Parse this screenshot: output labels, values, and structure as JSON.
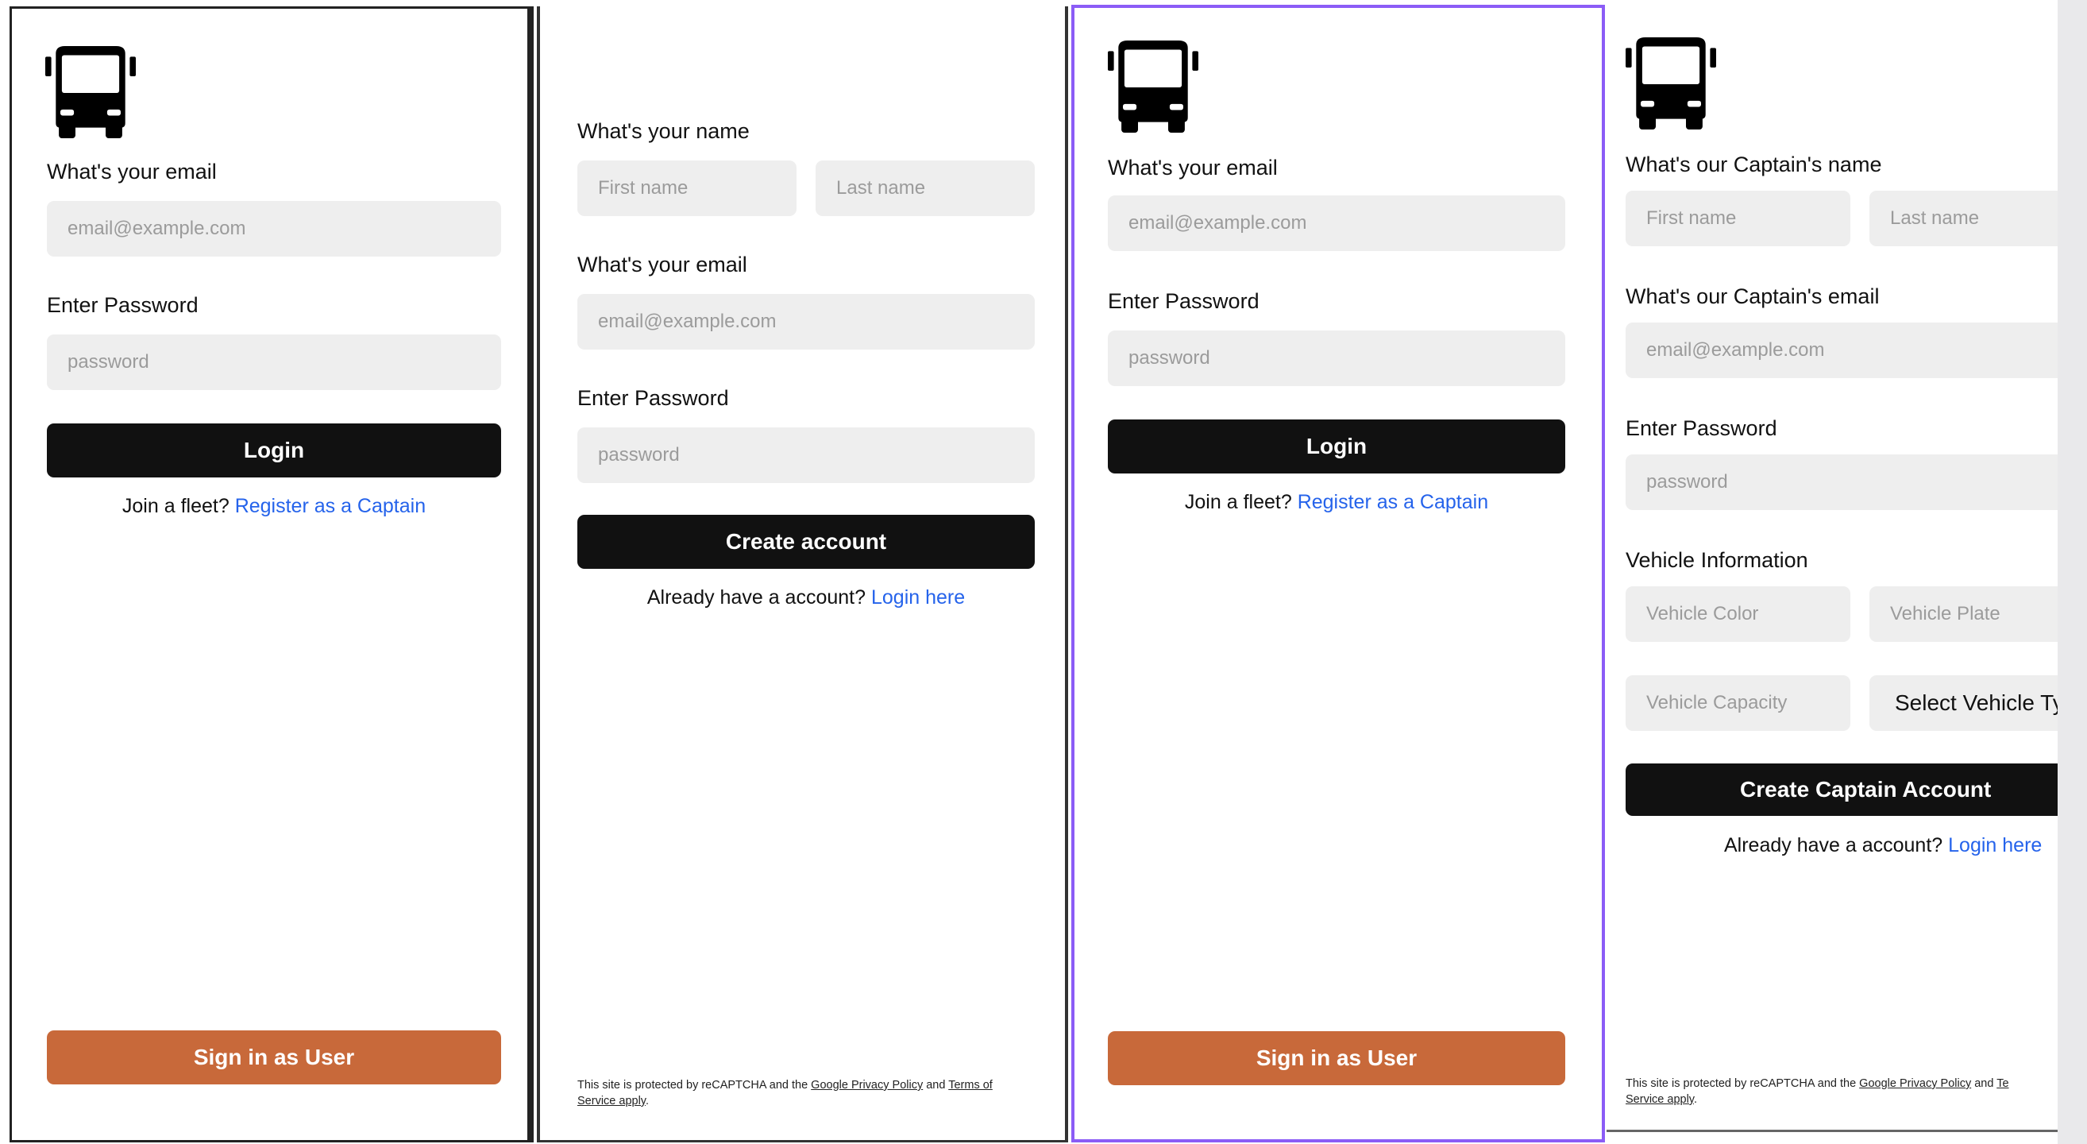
{
  "colors": {
    "accent_border": "#8b5cf6",
    "button_dark": "#111111",
    "button_orange": "#c8693a",
    "link": "#2563eb",
    "input_bg": "#eeeeee"
  },
  "logo_icon": "bus-icon",
  "panel1": {
    "email_label": "What's your email",
    "email_placeholder": "email@example.com",
    "password_label": "Enter Password",
    "password_placeholder": "password",
    "login_button": "Login",
    "join_prefix": "Join a fleet?",
    "join_link": "Register as a Captain",
    "sign_in_user_button": "Sign in as User"
  },
  "panel2": {
    "name_label": "What's your name",
    "first_name_placeholder": "First name",
    "last_name_placeholder": "Last name",
    "email_label": "What's your email",
    "email_placeholder": "email@example.com",
    "password_label": "Enter Password",
    "password_placeholder": "password",
    "create_button": "Create account",
    "have_account_prefix": "Already have a account?",
    "login_link": "Login here",
    "recaptcha_text": "This site is protected by reCAPTCHA and the",
    "privacy_link": "Google Privacy Policy",
    "and_text": "and",
    "terms_link": "Terms of Service apply",
    "period": "."
  },
  "panel3": {
    "email_label": "What's your email",
    "email_placeholder": "email@example.com",
    "password_label": "Enter Password",
    "password_placeholder": "password",
    "login_button": "Login",
    "join_prefix": "Join a fleet?",
    "join_link": "Register as a Captain",
    "sign_in_user_button": "Sign in as User"
  },
  "panel4": {
    "name_label": "What's our Captain's name",
    "first_name_placeholder": "First name",
    "last_name_placeholder": "Last name",
    "email_label": "What's our Captain's email",
    "email_placeholder": "email@example.com",
    "password_label": "Enter Password",
    "password_placeholder": "password",
    "vehicle_label": "Vehicle Information",
    "vehicle_color_placeholder": "Vehicle Color",
    "vehicle_plate_placeholder": "Vehicle Plate",
    "vehicle_capacity_placeholder": "Vehicle Capacity",
    "vehicle_type_select": "Select Vehicle Ty",
    "create_button": "Create Captain Account",
    "have_account_prefix": "Already have a account?",
    "login_link": "Login here",
    "recaptcha_text": "This site is protected by reCAPTCHA and the",
    "privacy_link": "Google Privacy Policy",
    "and_text": "and",
    "terms_link_part1": "Te",
    "terms_link_part2": "Service apply",
    "period": "."
  }
}
